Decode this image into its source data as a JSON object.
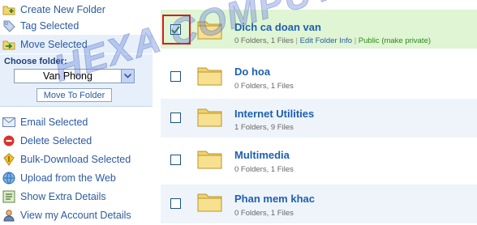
{
  "sidebar": {
    "top_items": [
      {
        "label": "Create New Folder",
        "icon": "folder-plus-icon"
      },
      {
        "label": "Tag Selected",
        "icon": "tag-icon"
      },
      {
        "label": "Move Selected",
        "icon": "move-arrow-icon"
      }
    ],
    "choose_folder_label": "Choose folder:",
    "folder_select_value": "Van Phong",
    "move_button_label": "Move To Folder",
    "bottom_items": [
      {
        "label": "Email Selected",
        "icon": "email-icon"
      },
      {
        "label": "Delete Selected",
        "icon": "delete-icon"
      },
      {
        "label": "Bulk-Download Selected",
        "icon": "download-icon"
      },
      {
        "label": "Upload from the Web",
        "icon": "upload-web-icon"
      },
      {
        "label": "Show Extra Details",
        "icon": "details-icon"
      },
      {
        "label": "View my Account Details",
        "icon": "account-icon"
      }
    ]
  },
  "folders": [
    {
      "name": "Dich ca doan van",
      "meta": "0 Folders, 1 Files",
      "edit_link": "Edit Folder Info",
      "visibility": "Public",
      "make_private": "(make private)",
      "checked": true
    },
    {
      "name": "Do hoa",
      "meta": "0 Folders, 1 Files",
      "checked": false
    },
    {
      "name": "Internet Utilities",
      "meta": "1 Folders, 9 Files",
      "checked": false
    },
    {
      "name": "Multimedia",
      "meta": "0 Folders, 1 Files",
      "checked": false
    },
    {
      "name": "Phan mem khac",
      "meta": "0 Folders, 1 Files",
      "checked": false
    }
  ],
  "watermark": "HEXA COMPUTER",
  "colors": {
    "link": "#2c5aa0",
    "selected_row": "#dff5d3",
    "panel": "#e7f0fa",
    "highlight": "#d81b1b"
  }
}
